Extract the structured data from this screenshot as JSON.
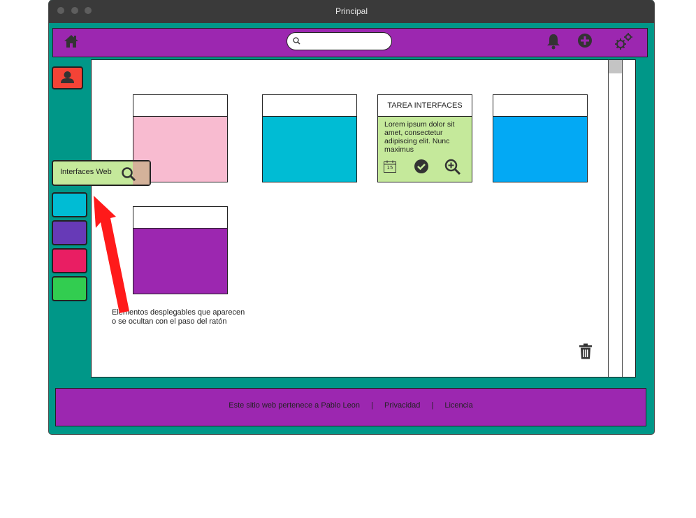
{
  "window": {
    "title": "Principal"
  },
  "topbar": {
    "home_icon": "home-icon",
    "search": {
      "placeholder": "",
      "value": ""
    },
    "notifications_icon": "bell-icon",
    "add_icon": "plus-circle-icon",
    "settings_icon": "gears-icon"
  },
  "sidebar": {
    "avatar_icon": "user-icon",
    "popup_label": "Interfaces Web",
    "items": [
      {
        "color": "#00bcd4"
      },
      {
        "color": "#673ab7"
      },
      {
        "color": "#e91e63"
      },
      {
        "color": "#32cd50"
      }
    ]
  },
  "cards": [
    {
      "title": "",
      "color": "#f8bbd0"
    },
    {
      "title": "",
      "color": "#00bcd4"
    },
    {
      "title": "TAREA INTERFACES",
      "color": "#c5e99b",
      "text": "Lorem ipsum dolor sit amet, consectetur adipiscing elit. Nunc maximus",
      "date": "15"
    },
    {
      "title": "",
      "color": "#03a9f4"
    },
    {
      "title": "",
      "color": "#9c27b0"
    }
  ],
  "annotation": {
    "line1": "Elementos desplegables que aparecen",
    "line2": "o se ocultan con el paso del ratón"
  },
  "trash_icon": "trash-icon",
  "footer": {
    "owner": "Este sitio web pertenece a Pablo Leon",
    "separator": "|",
    "privacy": "Privacidad",
    "license": "Licencia"
  }
}
